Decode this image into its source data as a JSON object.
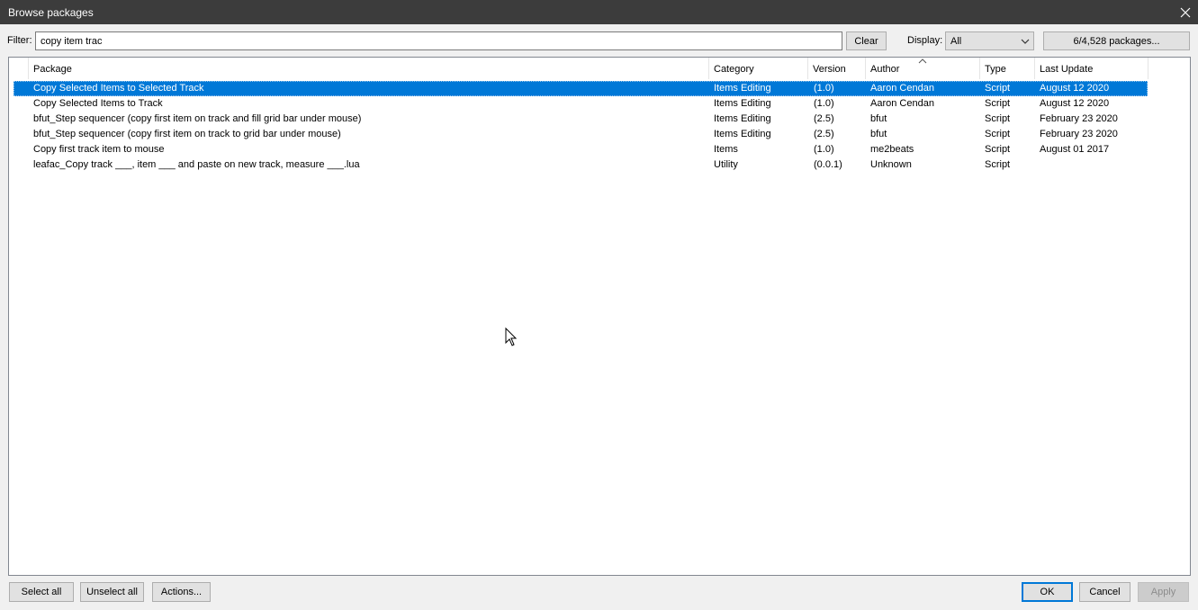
{
  "window": {
    "title": "Browse packages"
  },
  "filter": {
    "label": "Filter:",
    "value": "copy item trac",
    "clear_label": "Clear"
  },
  "display": {
    "label": "Display:",
    "selected": "All"
  },
  "count_button": "6/4,528 packages...",
  "columns": {
    "package": "Package",
    "category": "Category",
    "version": "Version",
    "author": "Author",
    "type": "Type",
    "last_update": "Last Update"
  },
  "rows": [
    {
      "package": "Copy Selected Items to Selected Track",
      "category": "Items Editing",
      "version": "(1.0)",
      "author": "Aaron Cendan",
      "type": "Script",
      "last_update": "August 12 2020"
    },
    {
      "package": "Copy Selected Items to Track",
      "category": "Items Editing",
      "version": "(1.0)",
      "author": "Aaron Cendan",
      "type": "Script",
      "last_update": "August 12 2020"
    },
    {
      "package": "bfut_Step sequencer (copy first item on track and fill grid bar under mouse)",
      "category": "Items Editing",
      "version": "(2.5)",
      "author": "bfut",
      "type": "Script",
      "last_update": "February 23 2020"
    },
    {
      "package": "bfut_Step sequencer (copy first item on track to grid bar under mouse)",
      "category": "Items Editing",
      "version": "(2.5)",
      "author": "bfut",
      "type": "Script",
      "last_update": "February 23 2020"
    },
    {
      "package": "Copy first track item to mouse",
      "category": "Items",
      "version": "(1.0)",
      "author": "me2beats",
      "type": "Script",
      "last_update": "August 01 2017"
    },
    {
      "package": "leafac_Copy track ___, item ___ and paste on new track, measure ___.lua",
      "category": "Utility",
      "version": "(0.0.1)",
      "author": "Unknown",
      "type": "Script",
      "last_update": ""
    }
  ],
  "footer": {
    "select_all": "Select all",
    "unselect_all": "Unselect all",
    "actions": "Actions...",
    "ok": "OK",
    "cancel": "Cancel",
    "apply": "Apply"
  },
  "colors": {
    "selection": "#0078d7",
    "titlebar": "#3c3c3c"
  }
}
